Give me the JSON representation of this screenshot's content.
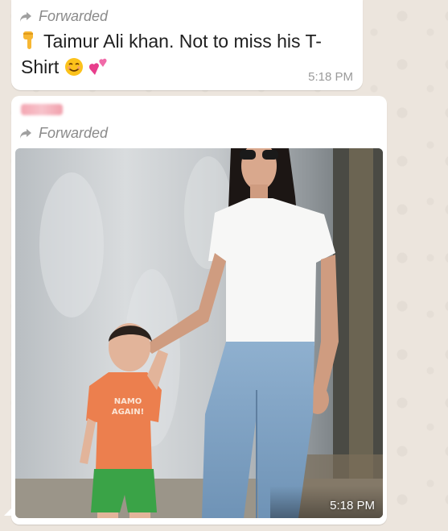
{
  "messages": [
    {
      "forwarded_label": "Forwarded",
      "text": "Taimur Ali khan.  Not to miss his T-Shirt",
      "time": "5:18 PM"
    },
    {
      "forwarded_label": "Forwarded",
      "photo_shirt_text": "NAMO AGAIN!",
      "time": "5:18 PM"
    }
  ],
  "icons": {
    "forward": "forward-arrow-icon",
    "point_down": "pointing-down-hand-emoji",
    "smile": "smiling-face-emoji",
    "hearts": "two-hearts-emoji"
  },
  "colors": {
    "chat_background": "#ece5dd",
    "bubble": "#ffffff",
    "meta_text": "#8a8a8a"
  }
}
